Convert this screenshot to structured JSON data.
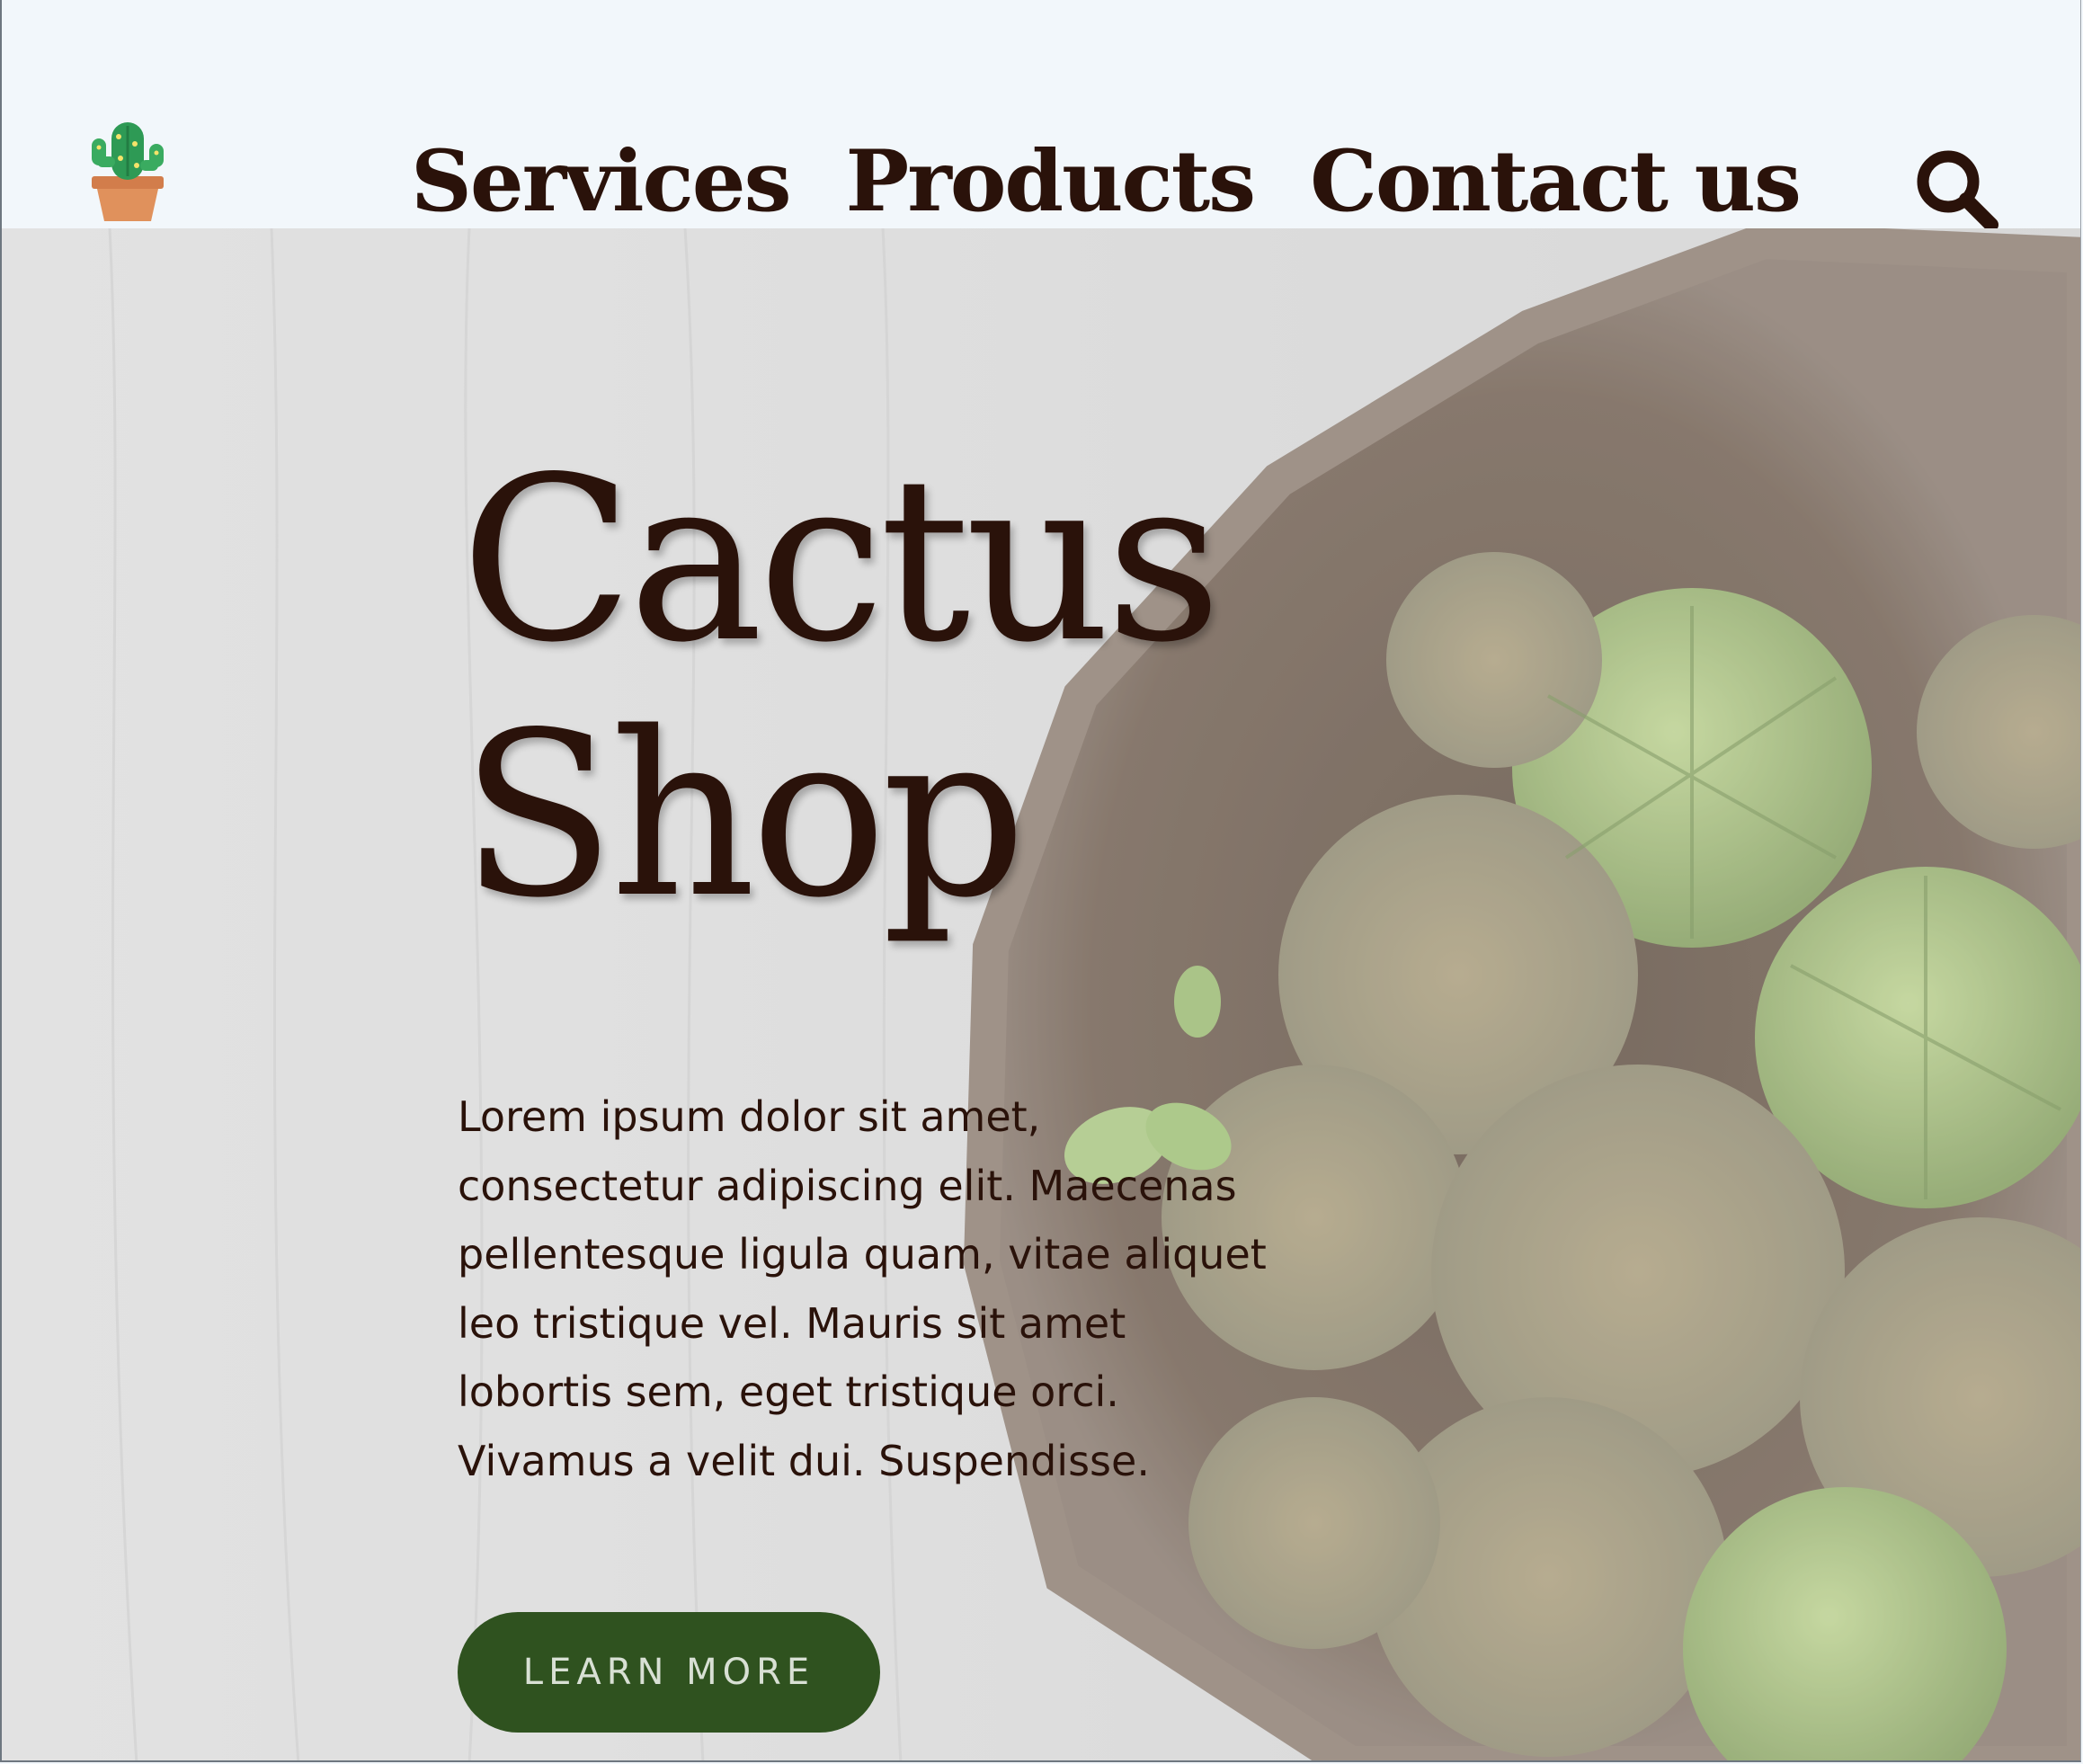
{
  "header": {
    "logo_icon": "cactus-pot-icon",
    "nav": [
      "Services",
      "Products",
      "Contact us"
    ],
    "search_icon": "search-icon"
  },
  "hero": {
    "title_line1": "Cactus",
    "title_line2": "Shop",
    "body": "Lorem ipsum dolor sit amet, consectetur adipiscing elit. Maecenas pellentesque ligula quam, vitae aliquet leo tristique vel. Mauris sit amet lobortis sem, eget tristique orci. Vivamus a velit dui. Suspendisse.",
    "cta_label": "LEARN MORE",
    "background_image": "cacti-in-wooden-bowl"
  },
  "colors": {
    "page_bg": "#f2f7fb",
    "text": "#2a120a",
    "cta_bg": "#2f521f",
    "cta_text": "#d8e0d4"
  }
}
